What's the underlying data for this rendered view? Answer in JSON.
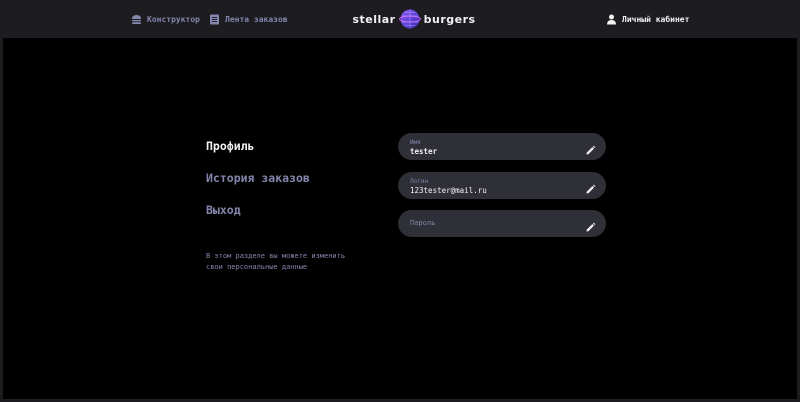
{
  "header": {
    "nav": {
      "constructor": "Конструктор",
      "feed": "Лента заказов",
      "account": "Личный кабинет"
    },
    "logo": {
      "left": "stellar",
      "right": "burgers"
    }
  },
  "profile": {
    "menu": {
      "profile": "Профиль",
      "orders": "История заказов",
      "logout": "Выход"
    },
    "note": "В этом разделе вы можете изменить свои персональные данные"
  },
  "form": {
    "name": {
      "label": "Имя",
      "value": "tester"
    },
    "login": {
      "label": "Логин",
      "value": "123tester@mail.ru"
    },
    "password": {
      "placeholder": "Пароль"
    }
  },
  "colors": {
    "background": "#000000",
    "header": "#1c1c21",
    "input": "#2f2f37",
    "inactive": "#8585ad",
    "text": "#f2f2f3"
  },
  "icons": {
    "constructor": "burger-icon",
    "feed": "list-icon",
    "account": "profile-icon",
    "edit": "edit-icon"
  }
}
